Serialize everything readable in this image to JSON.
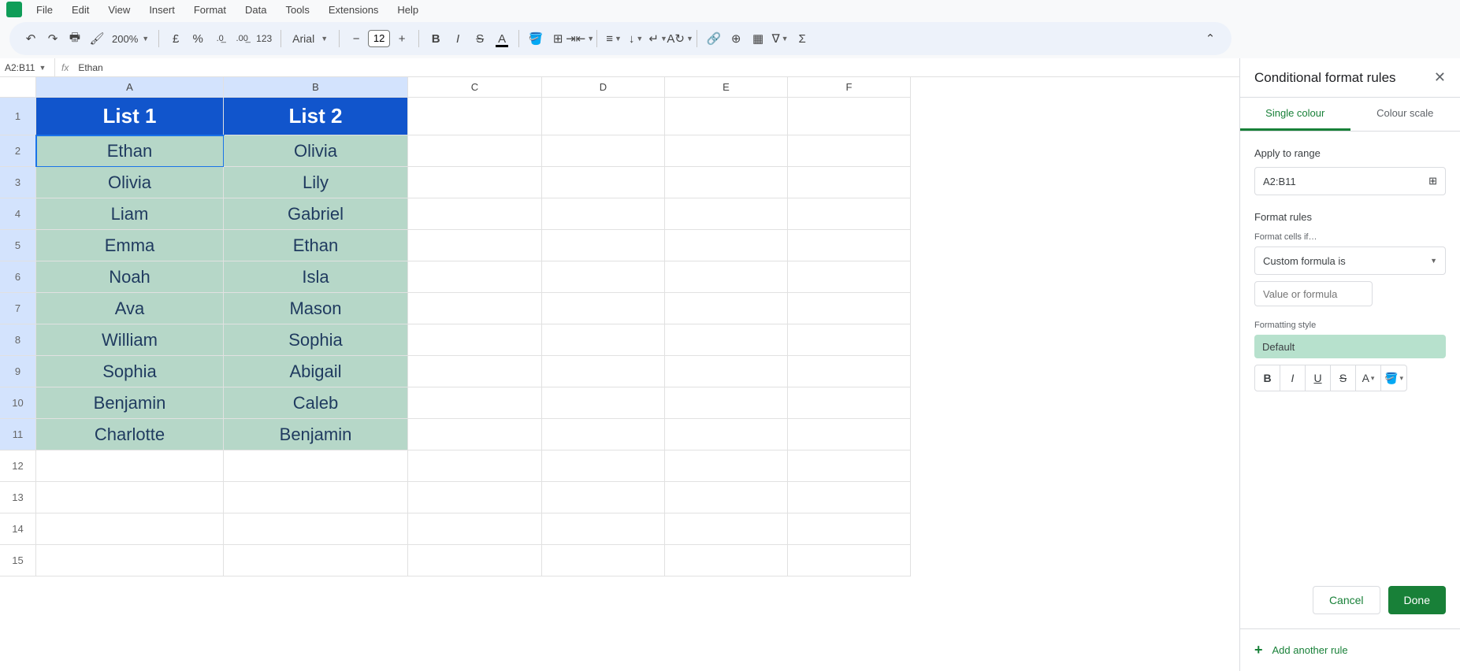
{
  "menu": [
    "File",
    "Edit",
    "View",
    "Insert",
    "Format",
    "Data",
    "Tools",
    "Extensions",
    "Help"
  ],
  "toolbar": {
    "zoom": "200%",
    "font": "Arial",
    "font_size": "12",
    "currency_symbol": "£",
    "percent": "%",
    "dec_dec": ".0",
    "inc_dec": ".00",
    "num_fmt": "123"
  },
  "name_box": "A2:B11",
  "formula": "Ethan",
  "fx_label": "fx",
  "columns": [
    "A",
    "B",
    "C",
    "D",
    "E",
    "F"
  ],
  "data_rows": [
    {
      "n": "1",
      "a": "List 1",
      "b": "List 2",
      "head": true
    },
    {
      "n": "2",
      "a": "Ethan",
      "b": "Olivia"
    },
    {
      "n": "3",
      "a": "Olivia",
      "b": "Lily"
    },
    {
      "n": "4",
      "a": "Liam",
      "b": "Gabriel"
    },
    {
      "n": "5",
      "a": "Emma",
      "b": "Ethan"
    },
    {
      "n": "6",
      "a": "Noah",
      "b": "Isla"
    },
    {
      "n": "7",
      "a": "Ava",
      "b": "Mason"
    },
    {
      "n": "8",
      "a": "William",
      "b": "Sophia"
    },
    {
      "n": "9",
      "a": "Sophia",
      "b": "Abigail"
    },
    {
      "n": "10",
      "a": "Benjamin",
      "b": "Caleb"
    },
    {
      "n": "11",
      "a": "Charlotte",
      "b": "Benjamin"
    },
    {
      "n": "12",
      "a": "",
      "b": ""
    },
    {
      "n": "13",
      "a": "",
      "b": ""
    },
    {
      "n": "14",
      "a": "",
      "b": ""
    },
    {
      "n": "15",
      "a": "",
      "b": ""
    }
  ],
  "sidepanel": {
    "title": "Conditional format rules",
    "tab_single": "Single colour",
    "tab_scale": "Colour scale",
    "apply_to_range_label": "Apply to range",
    "range_value": "A2:B11",
    "format_rules_label": "Format rules",
    "format_cells_if_label": "Format cells if…",
    "rule_selected": "Custom formula is",
    "value_placeholder": "Value or formula",
    "formatting_style_label": "Formatting style",
    "style_preview": "Default",
    "cancel": "Cancel",
    "done": "Done",
    "add_rule": "Add another rule"
  }
}
